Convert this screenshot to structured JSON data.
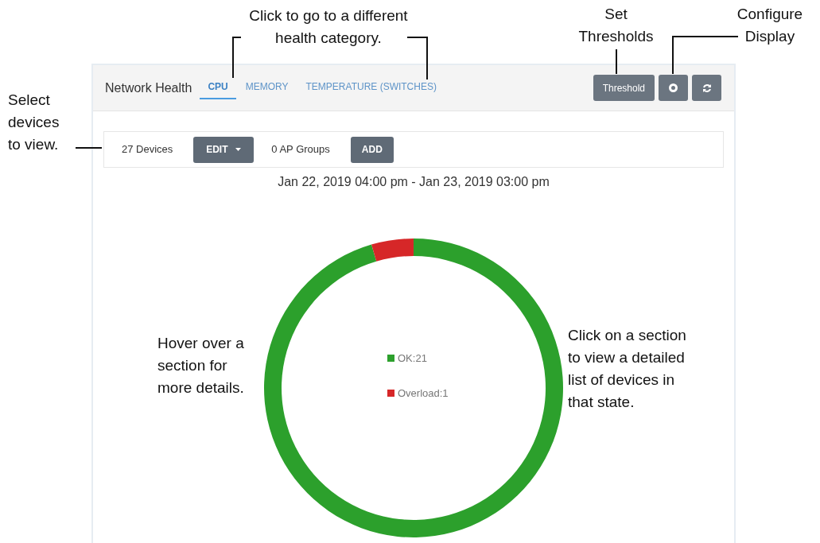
{
  "panel": {
    "title": "Network Health",
    "tabs": [
      {
        "label": "CPU",
        "selected": true
      },
      {
        "label": "MEMORY",
        "selected": false
      },
      {
        "label": "TEMPERATURE (SWITCHES)",
        "selected": false
      }
    ],
    "threshold_button": "Threshold",
    "device_bar": {
      "devices": "27 Devices",
      "edit_button": "EDIT",
      "groups": "0 AP Groups",
      "add_button": "ADD"
    },
    "date_range": "Jan 22, 2019 04:00 pm - Jan 23, 2019 03:00 pm",
    "chart_data": {
      "type": "donut",
      "categories": [
        "OK",
        "Overload"
      ],
      "values": [
        21,
        1
      ],
      "colors": [
        "#2ca02c",
        "#d62728"
      ],
      "value_labels": [
        ":21",
        ":1"
      ],
      "legend": "center"
    }
  },
  "callouts": [
    {
      "text": "Click to go to a different health category."
    },
    {
      "text": "Set Thresholds"
    },
    {
      "text": "Configure Display"
    },
    {
      "text": "Select devices to view."
    },
    {
      "text": "Hover over a section for more details."
    },
    {
      "text": "Click on a section to view a detailed list of devices in that state."
    }
  ]
}
